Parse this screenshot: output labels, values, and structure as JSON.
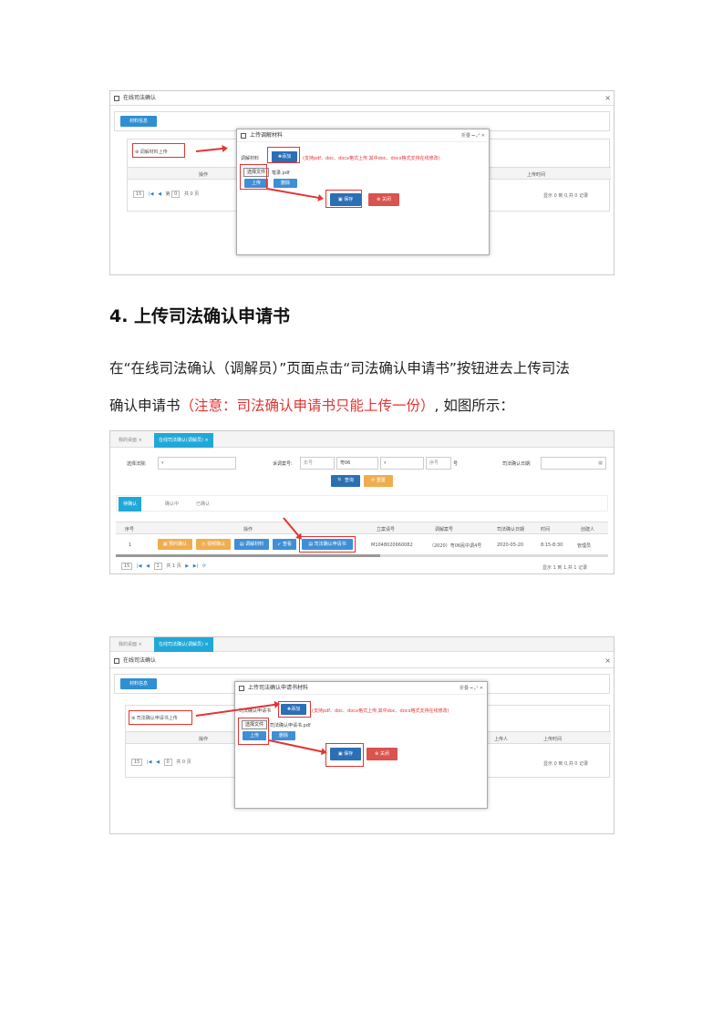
{
  "shot1": {
    "window_title": "在线司法确认",
    "close": "×",
    "tab": "材料信息",
    "upload_label": "调解材料上传",
    "col_op": "操作",
    "col_time": "上传时间",
    "pager_size": "15",
    "pager_text": "第",
    "pager_page": "0",
    "pager_of": "共 0 页",
    "pager_info": "显示 0 到 0,共 0 记录",
    "modal": {
      "title": "上传调解材料",
      "ctrls": "折叠  ━  ⤢  ✕",
      "field_label": "调解材料",
      "add": "✚添加",
      "hint": "(支持pdf、doc、docx格式上传,其中doc、docx格式支持在线修改)",
      "choose_file": "选择文件",
      "file_name": "笔录.pdf",
      "upload": "上传",
      "delete": "删除",
      "save": "保存",
      "close": "关闭"
    }
  },
  "section": {
    "heading": "4. 上传司法确认申请书",
    "para1": "在“在线司法确认（调解员）”页面点击“司法确认申请书”按钮进去上传司法",
    "para2_a": "确认申请书",
    "para2_red": "（注意：司法确认申请书只能上传一份）",
    "para2_b": ", 如图所示："
  },
  "shot2": {
    "tab_home": "我的桌面",
    "tab_active": "在线司法确认(调解员)",
    "court_label": "选择法院:",
    "case_label": "诉调案号:",
    "ph_no": "年号",
    "ph_type": "粤06",
    "ph_seq": "序号",
    "hao": "号",
    "date_label": "司法确认日期:",
    "query": "查询",
    "reset": "重置",
    "subtab1": "待确认",
    "subtab2": "确认中",
    "subtab3": "已确认",
    "headers": [
      "序号",
      "操作",
      "立案请号",
      "调解案号",
      "司法确认日期",
      "时间",
      "创建人"
    ],
    "row": {
      "no": "1",
      "b1": "▦ 预约确认",
      "b2": "◷ 视频确认",
      "b3": "▤ 调解材料",
      "b4": "➶ 查看",
      "b5": "▤ 司法确认申请书",
      "case_id": "M1048020660082",
      "med_no": "（2020）粤06民中调4号",
      "date": "2020-05-20",
      "time": "8:15-8:30",
      "creator": "管理员"
    },
    "pager_size": "15",
    "pager_page": "1",
    "pager_of": "共 1 页",
    "pager_info": "显示 1 到 1,共 1 记录"
  },
  "shot3": {
    "tab_home": "我的桌面",
    "tab_active": "在线司法确认(调解员)",
    "window_title": "在线司法确认",
    "close": "×",
    "tab": "材料信息",
    "upload_label": "司法确认申请书上传",
    "col_op": "操作",
    "col_uploader": "上传人",
    "col_time": "上传时间",
    "pager_size": "15",
    "pager_page": "0",
    "pager_of": "共 0 页",
    "pager_info": "显示 0 到 0,共 0 记录",
    "modal": {
      "title": "上传司法确认申请书材料",
      "ctrls": "折叠  ━  ⤢  ✕",
      "field_label": "司法确认申请书",
      "add": "✚添加",
      "hint": "(支持pdf、doc、docx格式上传,其中doc、docx格式支持在线修改)",
      "choose_file": "选择文件",
      "file_name": "司法确认申请书.pdf",
      "upload": "上传",
      "delete": "删除",
      "save": "保存",
      "close": "关闭"
    }
  }
}
